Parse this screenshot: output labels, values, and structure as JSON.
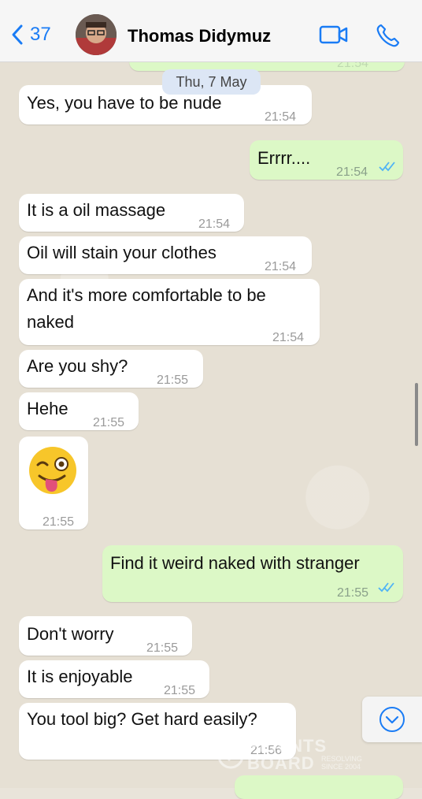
{
  "header": {
    "back_count": "37",
    "contact_name": "Thomas Didymuz"
  },
  "date_separator": "Thu, 7 May",
  "top_partial_time": "21:54",
  "messages": [
    {
      "text": "Yes, you have to be nude",
      "time": "21:54",
      "direction": "in"
    },
    {
      "text": "Errrr....",
      "time": "21:54",
      "direction": "out"
    },
    {
      "text": "It is a oil massage",
      "time": "21:54",
      "direction": "in"
    },
    {
      "text": "Oil will stain your clothes",
      "time": "21:54",
      "direction": "in"
    },
    {
      "text_line1": "And it's more comfortable to be",
      "text_line2": "naked",
      "time": "21:54",
      "direction": "in"
    },
    {
      "text": "Are you shy?",
      "time": "21:55",
      "direction": "in"
    },
    {
      "text": "Hehe",
      "time": "21:55",
      "direction": "in"
    },
    {
      "text": "",
      "emoji": "winking-face-with-tongue",
      "time": "21:55",
      "direction": "in"
    },
    {
      "text": "Find it weird naked with stranger",
      "time": "21:55",
      "direction": "out"
    },
    {
      "text": "Don't worry",
      "time": "21:55",
      "direction": "in"
    },
    {
      "text": "It is enjoyable",
      "time": "21:55",
      "direction": "in"
    },
    {
      "text": "You tool big? Get hard easily?",
      "time": "21:56",
      "direction": "in"
    }
  ],
  "watermark": {
    "line1": "PLAINTS",
    "line2": "BOARD",
    "small1": "RESOLVING",
    "small2": "SINCE 2004"
  },
  "colors": {
    "accent": "#1a7cf5",
    "outgoing_bubble": "#dcf8c6",
    "incoming_bubble": "#ffffff",
    "read_ticks": "#4fb3f6"
  }
}
